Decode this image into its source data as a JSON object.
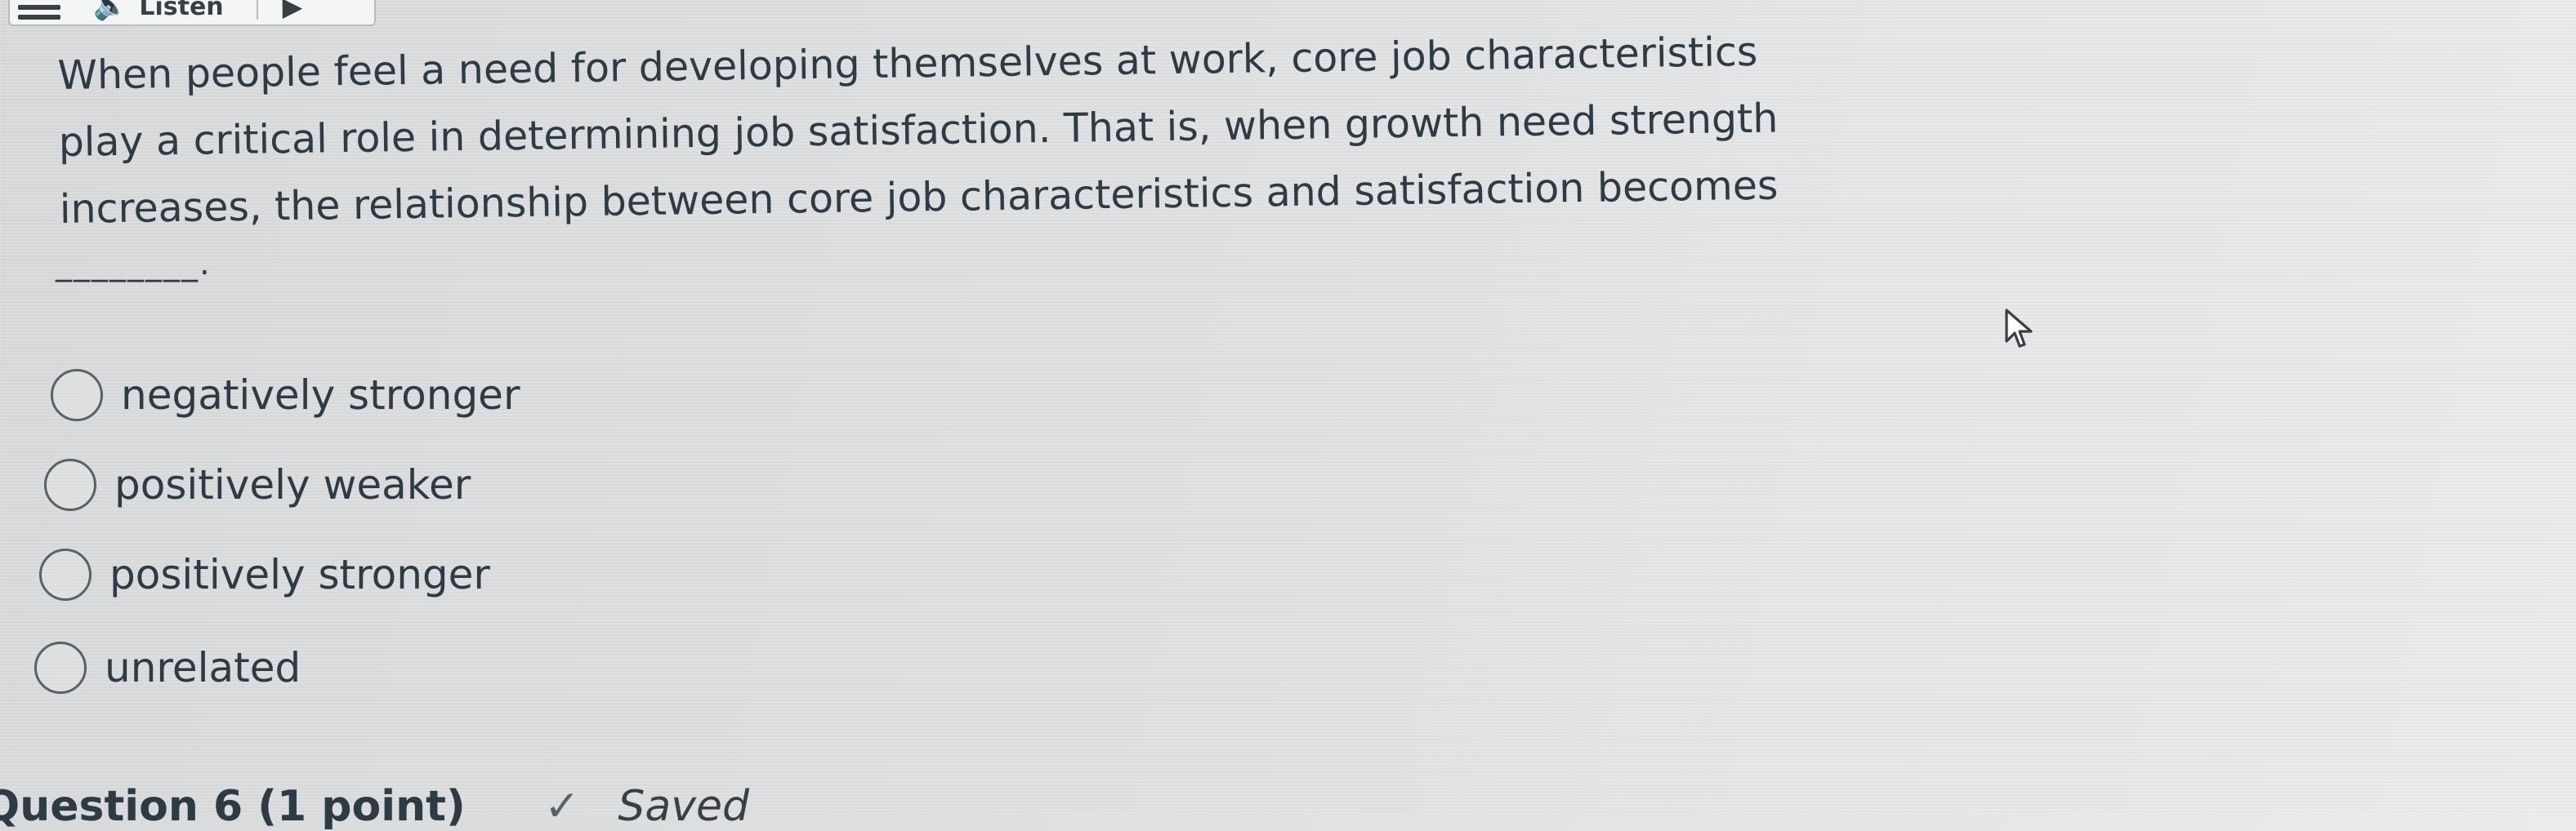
{
  "toolbar": {
    "menu_icon": "hamburger-icon",
    "speaker_icon": "speaker-icon",
    "listen_label": "Listen",
    "play_icon": "play-icon"
  },
  "question": {
    "lines": [
      "When people feel a need for developing themselves at work, core job characteristics",
      "play a critical role in determining job satisfaction. That is, when growth need strength",
      "increases, the relationship between core job characteristics and satisfaction becomes"
    ],
    "blank": "________."
  },
  "options": [
    {
      "label": "negatively stronger",
      "selected": false
    },
    {
      "label": "positively weaker",
      "selected": false
    },
    {
      "label": "positively stronger",
      "selected": false
    },
    {
      "label": "unrelated",
      "selected": false
    }
  ],
  "footer": {
    "question_label": "Question 6 (1 point)",
    "check_icon": "checkmark-icon",
    "saved_label": "Saved"
  },
  "cursor_icon": "mouse-pointer-icon"
}
